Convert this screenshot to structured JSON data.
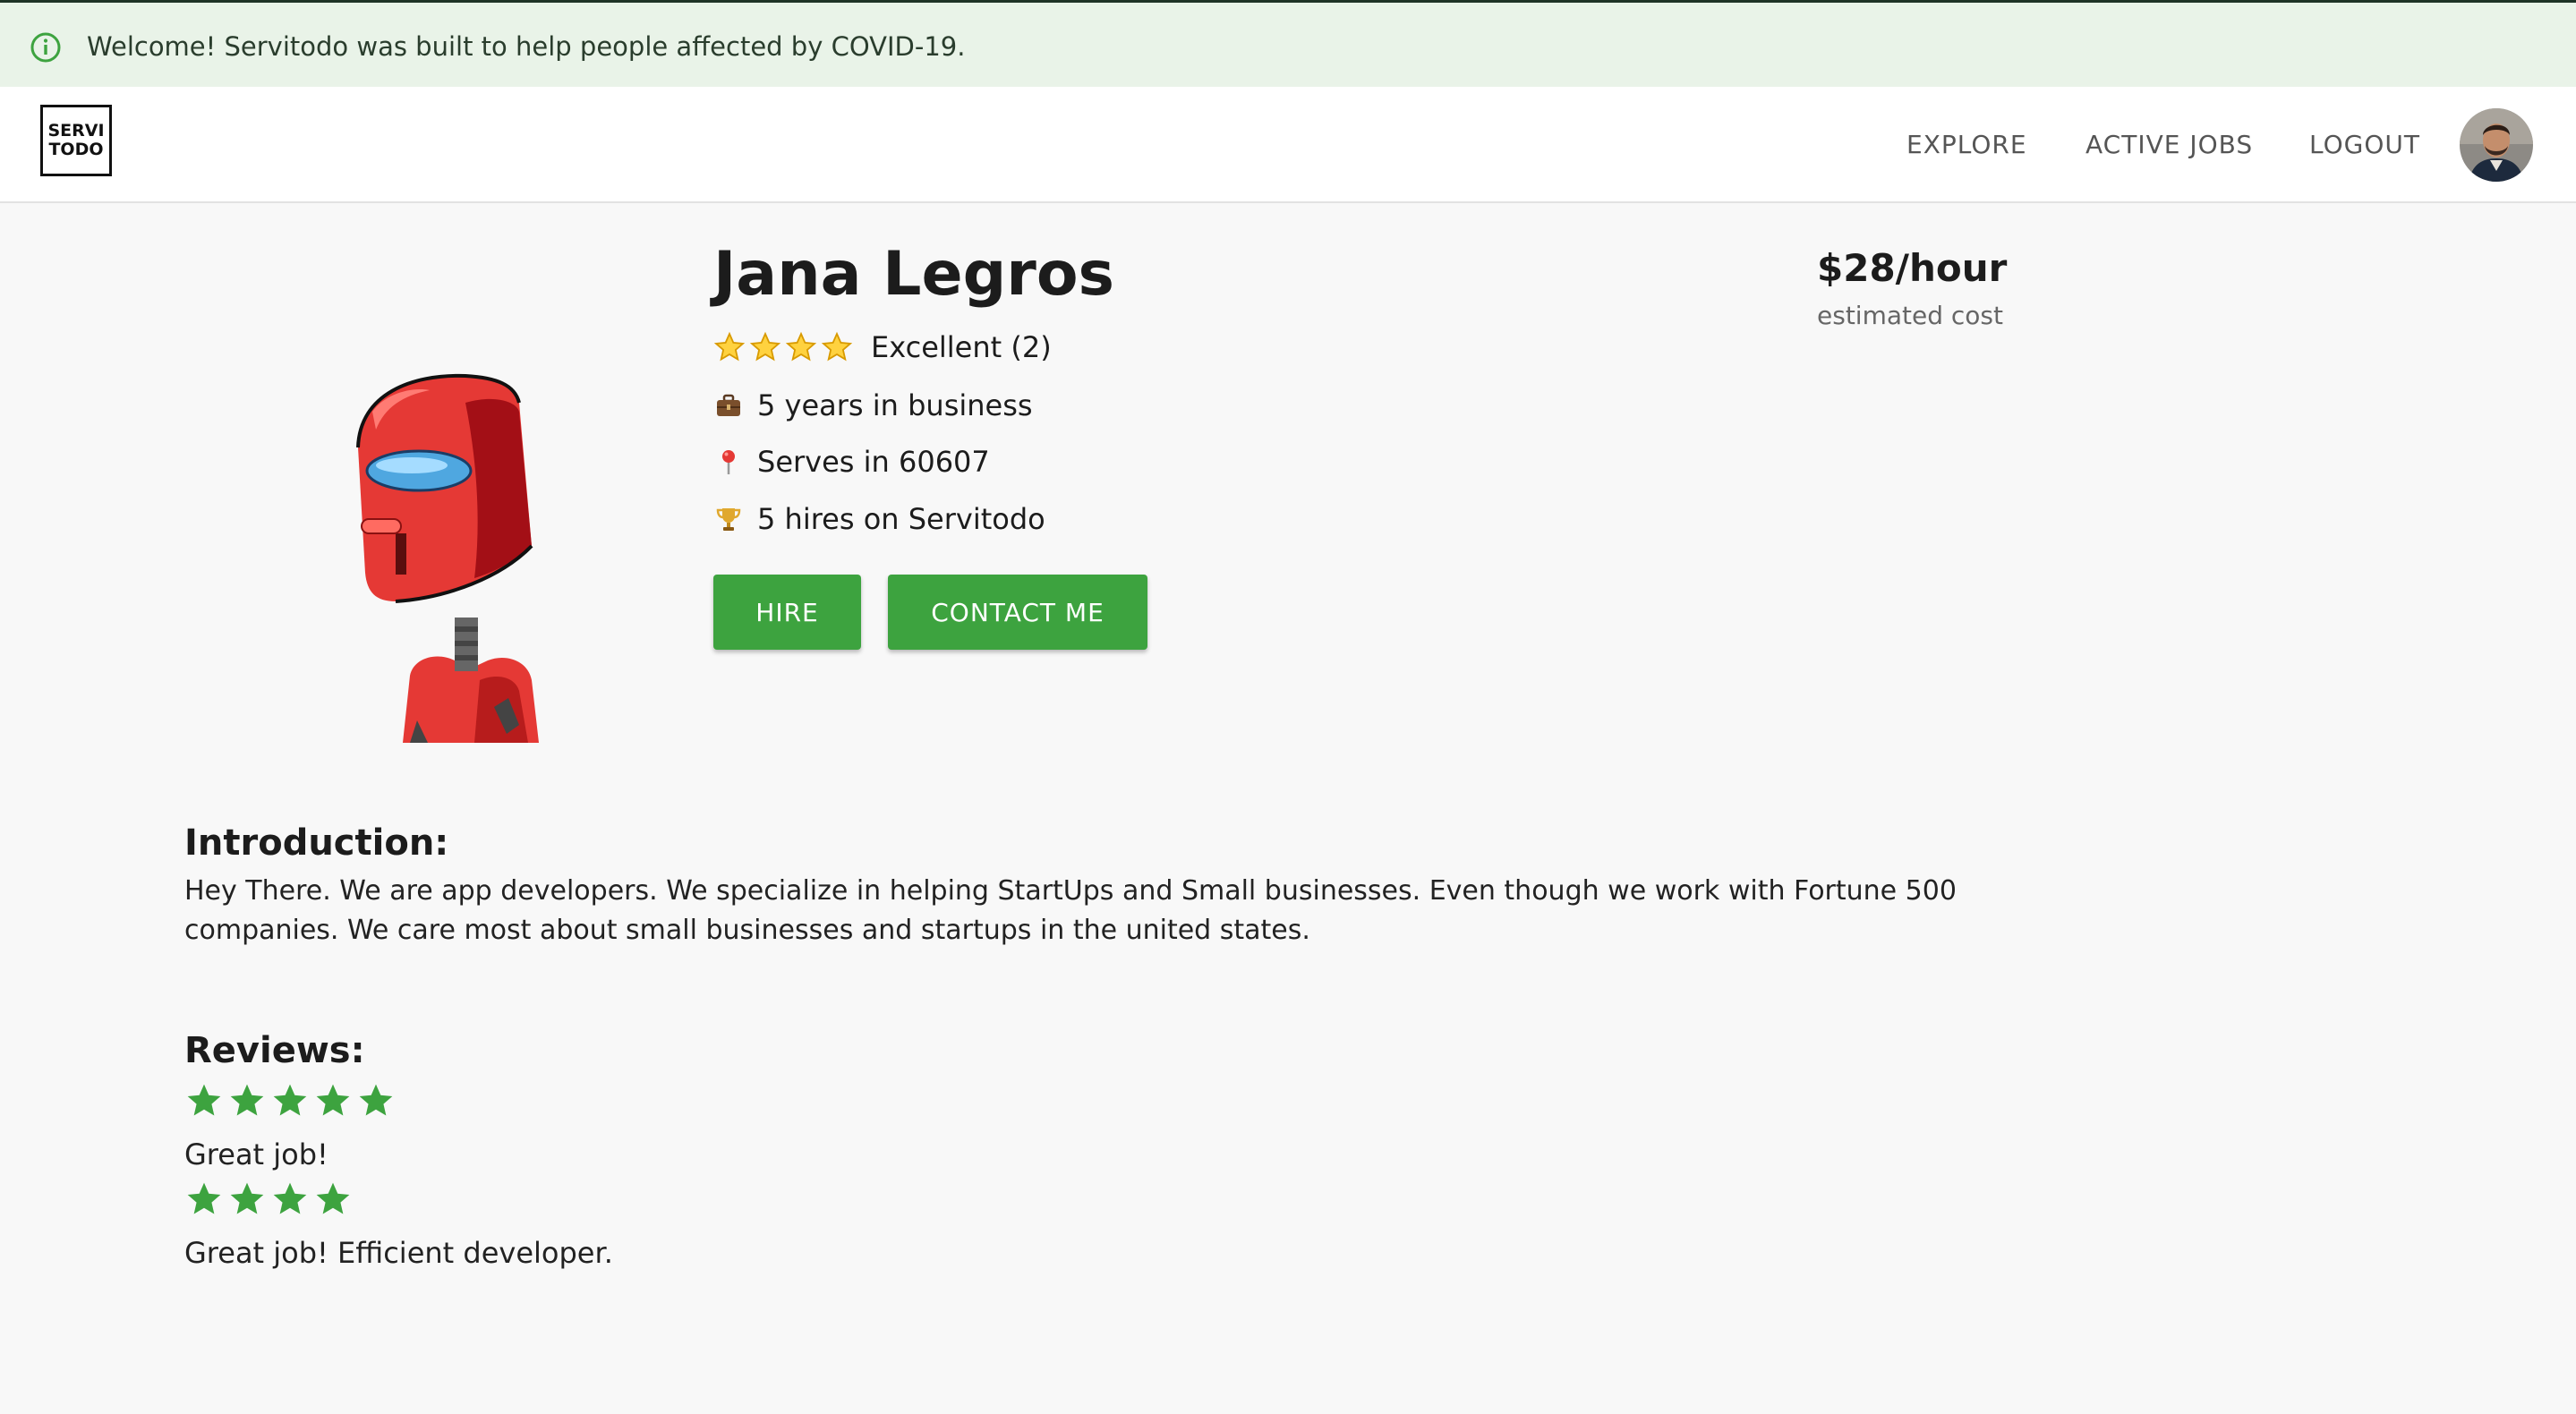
{
  "banner": {
    "icon": "info-icon",
    "text": "Welcome! Servitodo was built to help people affected by COVID-19."
  },
  "header": {
    "logo_line1": "SERVI",
    "logo_line2": "TODO",
    "nav": {
      "explore": "EXPLORE",
      "active_jobs": "ACTIVE JOBS",
      "logout": "LOGOUT"
    }
  },
  "profile": {
    "name": "Jana Legros",
    "rating_stars": 4,
    "rating_label": "Excellent (2)",
    "years": "5 years in business",
    "serves": "Serves in 60607",
    "hires": "5 hires on Servitodo",
    "hire_label": "HIRE",
    "contact_label": "CONTACT ME",
    "price": "$28/hour",
    "price_sub": "estimated cost"
  },
  "introduction": {
    "title": "Introduction:",
    "text": "Hey There. We are app developers. We specialize in helping StartUps and Small businesses. Even though we work with Fortune 500 companies. We care most about small businesses and startups in the united states."
  },
  "reviews": {
    "title": "Reviews:",
    "items": [
      {
        "stars": 5,
        "text": "Great job!"
      },
      {
        "stars": 4,
        "text": "Great job! Efficient developer."
      }
    ]
  },
  "colors": {
    "accent": "#3da33f",
    "banner_bg": "#e9f3e8",
    "page_bg": "#f8f8f8"
  }
}
